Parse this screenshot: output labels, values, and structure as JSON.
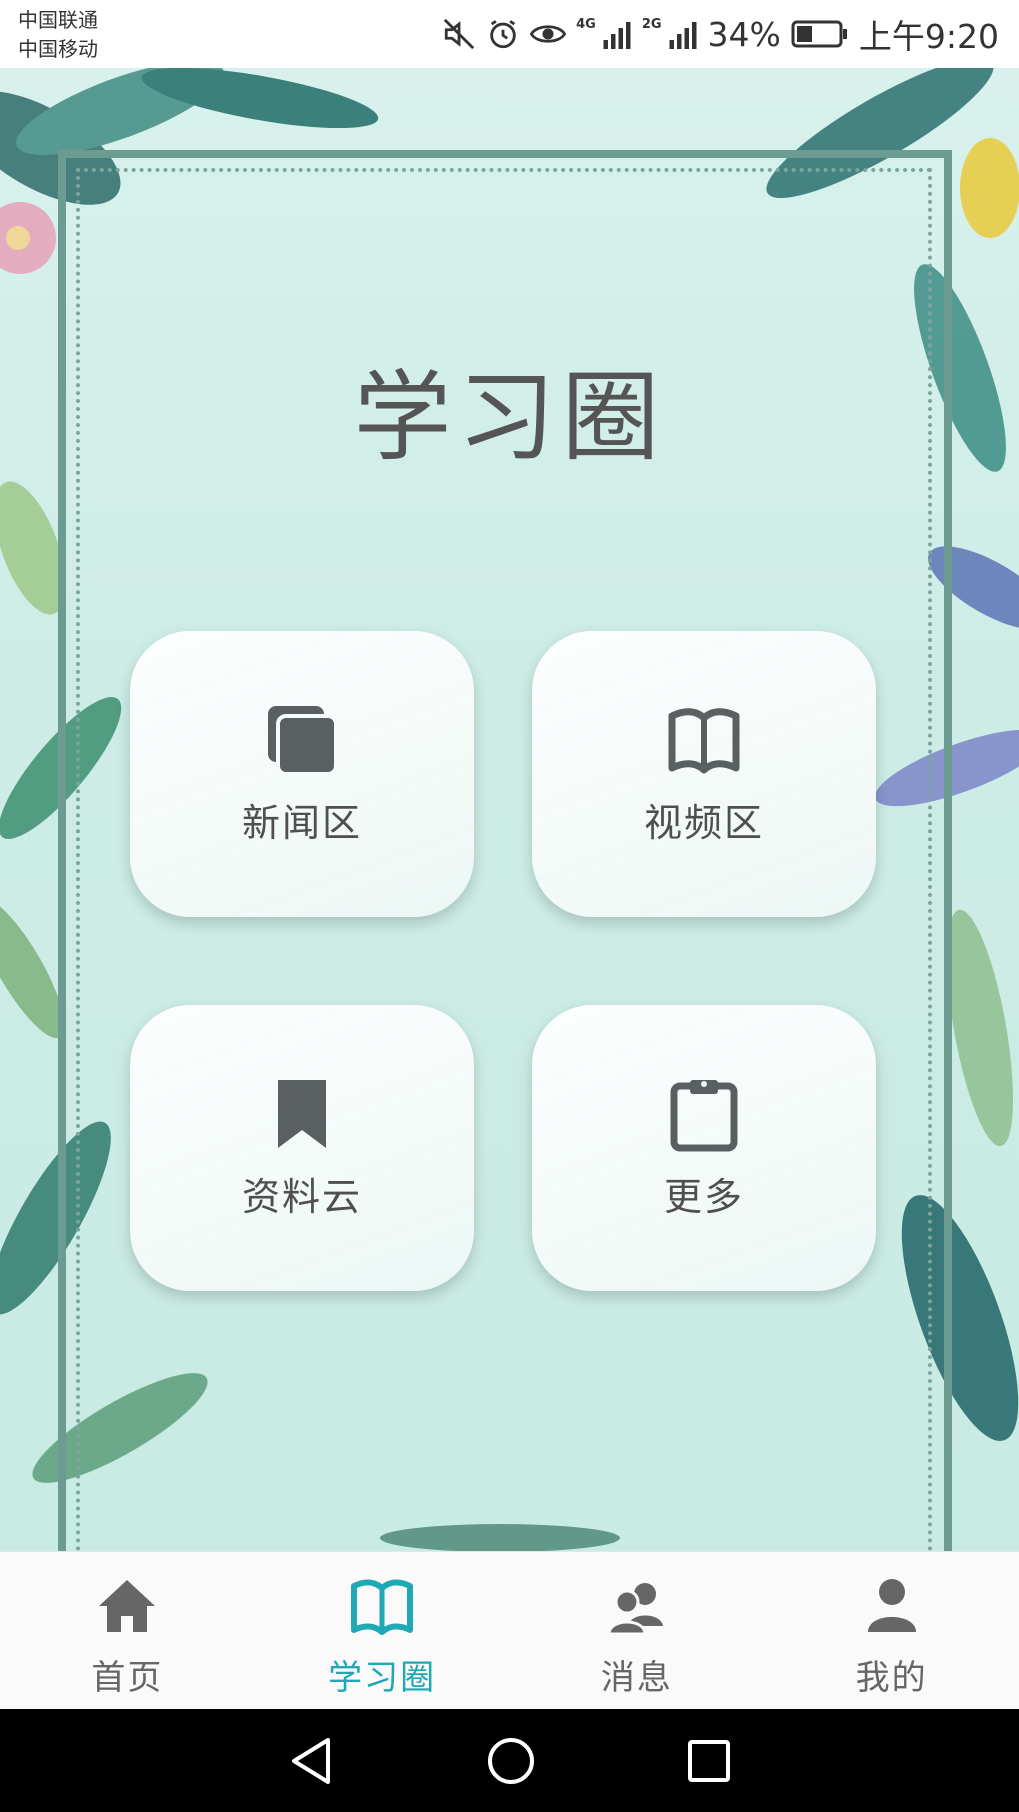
{
  "status_bar": {
    "carrier_1": "中国联通",
    "carrier_2": "中国移动",
    "net_1": "4G",
    "net_2": "2G",
    "battery": "34%",
    "time": "上午9:20",
    "icons": [
      "mute-icon",
      "alarm-icon",
      "eye-comfort-icon",
      "signal-icon",
      "battery-icon"
    ]
  },
  "page": {
    "title": "学习圈"
  },
  "tiles": [
    {
      "label": "新闻区",
      "icon": "news-stack-icon"
    },
    {
      "label": "视频区",
      "icon": "open-book-icon"
    },
    {
      "label": "资料云",
      "icon": "bookmark-icon"
    },
    {
      "label": "更多",
      "icon": "clipboard-icon"
    }
  ],
  "bottom_nav": {
    "active_color": "#1fa8b5",
    "items": [
      {
        "label": "首页",
        "icon": "home-icon"
      },
      {
        "label": "学习圈",
        "icon": "open-book-icon",
        "active": true
      },
      {
        "label": "消息",
        "icon": "people-icon"
      },
      {
        "label": "我的",
        "icon": "person-icon"
      }
    ]
  },
  "system_nav": [
    "back-icon",
    "home-circle-icon",
    "recents-icon"
  ]
}
